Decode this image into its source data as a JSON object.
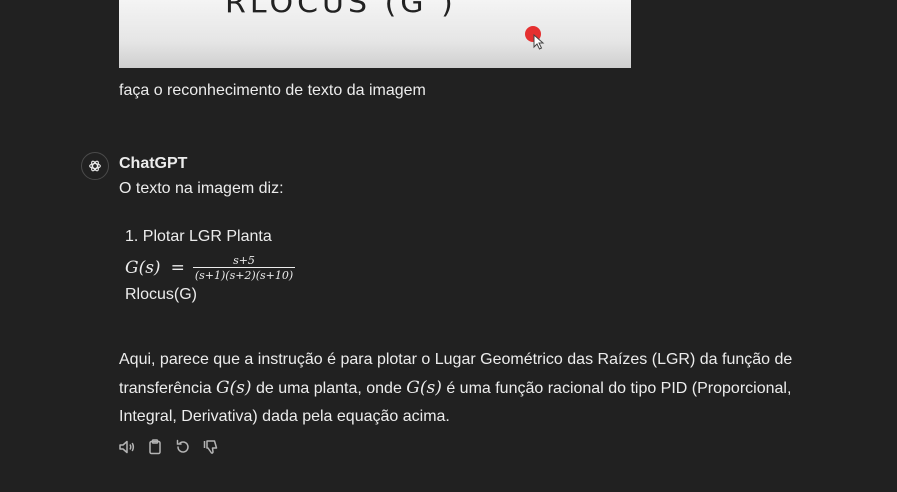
{
  "attachment": {
    "handwritten_text": "RLOCUS (G )"
  },
  "user_message": "faça o reconhecimento de texto da imagem",
  "assistant": {
    "name": "ChatGPT",
    "intro": "O texto na imagem diz:",
    "list_item": "1. Plotar LGR Planta",
    "formula": {
      "lhs": "G(s)",
      "eq": "=",
      "numerator": "s+5",
      "denominator": "(s+1)(s+2)(s+10)"
    },
    "rlocus_line": "Rlocus(G)",
    "paragraph": {
      "part1": "Aqui, parece que a instrução é para plotar o Lugar Geométrico das Raízes (LGR) da função de transferência ",
      "math1": "G(s)",
      "part2": " de uma planta, onde ",
      "math2": "G(s)",
      "part3": " é uma função racional do tipo PID (Proporcional, Integral, Derivativa) dada pela equação acima."
    }
  },
  "actions": [
    {
      "name": "read-aloud",
      "icon": "speaker-icon"
    },
    {
      "name": "copy",
      "icon": "clipboard-icon"
    },
    {
      "name": "regenerate",
      "icon": "refresh-icon"
    },
    {
      "name": "bad-response",
      "icon": "thumbs-down-icon"
    }
  ],
  "colors": {
    "background": "#212121",
    "text": "#ececec",
    "icon": "#b4b4b4",
    "red_dot": "#e53030"
  }
}
